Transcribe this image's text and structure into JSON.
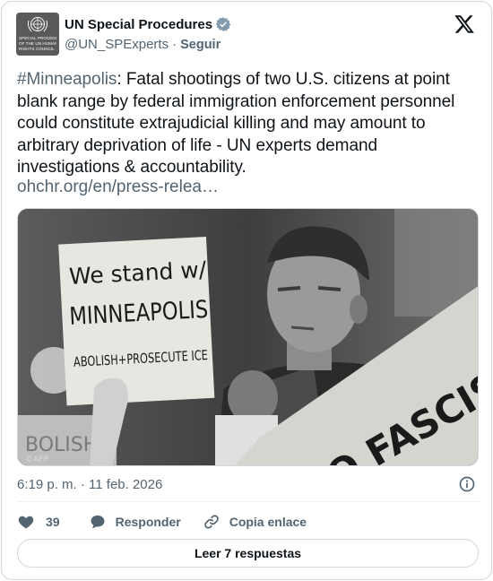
{
  "header": {
    "display_name": "UN Special Procedures",
    "handle": "@UN_SPExperts",
    "separator": "·",
    "follow_label": "Seguir",
    "avatar_text": [
      "SPECIAL PROCEDURES",
      "OF THE UN HUMAN",
      "RIGHTS COUNCIL"
    ]
  },
  "tweet": {
    "hashtag": "#Minneapolis",
    "body": ": Fatal shootings of two U.S. citizens at point blank range by federal immigration enforcement personnel could constitute extrajudicial killing and may amount to arbitrary deprivation of life - UN experts demand investigations & accountability.",
    "link": "ohchr.org/en/press-relea…"
  },
  "photo": {
    "sign_lines": [
      "We stand w/",
      "MINNEAPOLIS",
      "ABOLISH+PROSECUTE ICE"
    ],
    "banner_text": "NO FASCIST",
    "bg_sign_text": "BOLISH",
    "credit": "©AFP"
  },
  "meta": {
    "timestamp": "6:19 p. m. · 11 feb. 2026"
  },
  "actions": {
    "like_count": "39",
    "reply_label": "Responder",
    "copy_label": "Copia enlace"
  },
  "footer": {
    "read_replies_label": "Leer 7 respuestas"
  },
  "icons": {
    "verified": "verified-badge-icon",
    "x_logo": "x-logo-icon",
    "info": "info-icon",
    "like": "heart-icon",
    "reply": "speech-bubble-icon",
    "copy": "link-icon"
  },
  "colors": {
    "text_primary": "#0f1419",
    "text_secondary": "#536471",
    "border": "#cfd9de"
  }
}
